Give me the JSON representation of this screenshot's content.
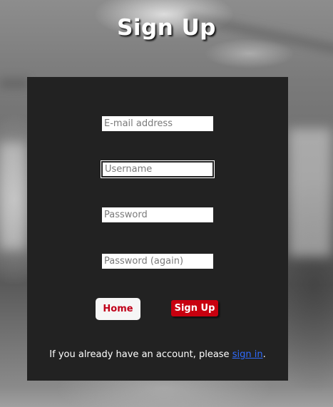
{
  "page": {
    "title": "Sign Up"
  },
  "form": {
    "email_placeholder": "E-mail address",
    "username_placeholder": "Username",
    "password_placeholder": "Password",
    "password_again_placeholder": "Password (again)",
    "home_label": "Home",
    "signup_label": "Sign Up",
    "footer_prefix": "If you already have an account, please ",
    "signin_link_label": "sign in",
    "footer_suffix": "."
  },
  "colors": {
    "panel_background": "#222222",
    "accent_red": "#c8000f",
    "link_blue": "#2f6bff"
  }
}
